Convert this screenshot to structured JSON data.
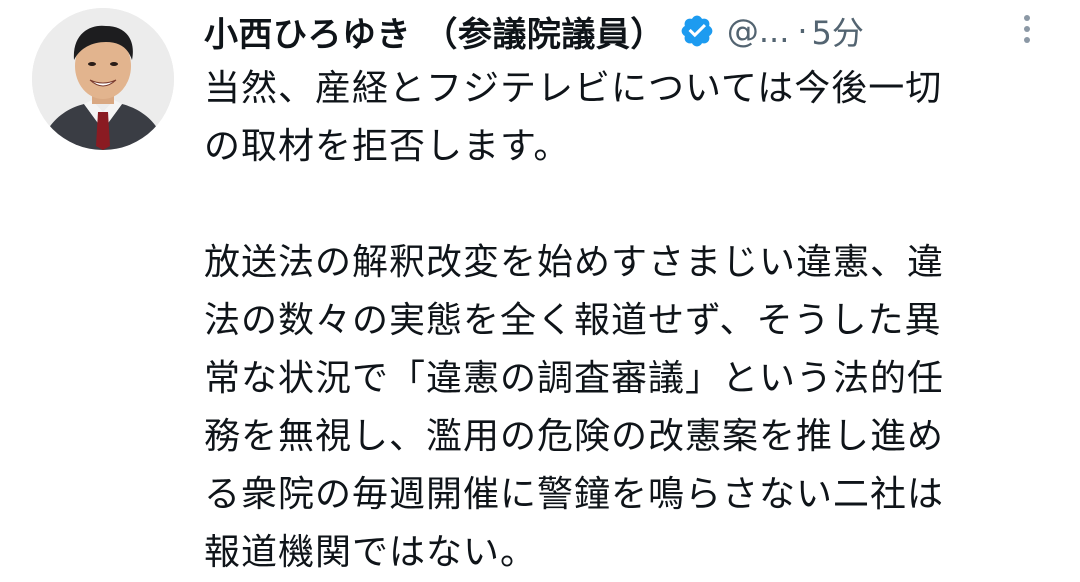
{
  "author": {
    "display_name": "小西ひろゆき （参議院議員）",
    "handle": "@...",
    "separator": "·",
    "time": "5分",
    "verified": true,
    "verified_color": "#1d9bf0"
  },
  "tweet": {
    "paragraph1": [
      "当然、産経とフジテレビについては今後一切",
      "の取材を拒否します。"
    ],
    "paragraph2": [
      "放送法の解釈改変を始めすさまじい違憲、違",
      "法の数々の実態を全く報道せず、そうした異",
      "常な状況で「違憲の調査審議」という法的任",
      "務を無視し、濫用の危険の改憲案を推し進め",
      "る衆院の毎週開催に警鐘を鳴らさない二社は",
      "報道機関ではない。"
    ]
  },
  "icons": {
    "avatar": "profile-photo",
    "verified": "verified-badge-icon",
    "more": "more-options-icon"
  },
  "colors": {
    "text": "#0f1419",
    "secondary": "#536471",
    "background": "#ffffff"
  }
}
